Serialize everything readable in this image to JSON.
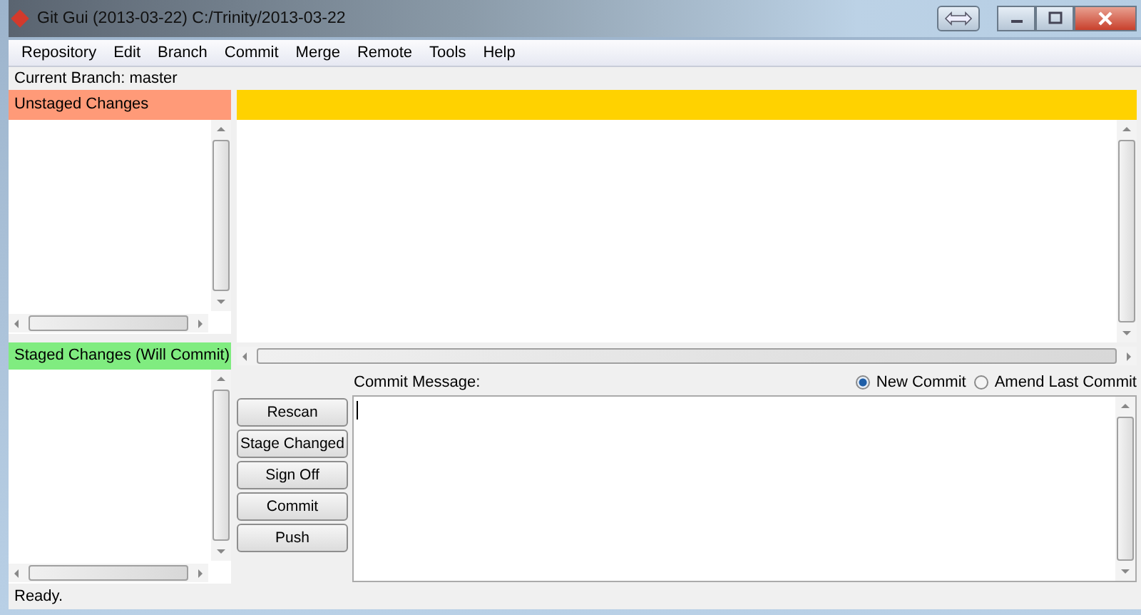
{
  "window": {
    "title": "Git Gui (2013-03-22) C:/Trinity/2013-03-22"
  },
  "menu": [
    "Repository",
    "Edit",
    "Branch",
    "Commit",
    "Merge",
    "Remote",
    "Tools",
    "Help"
  ],
  "current_branch": "Current Branch: master",
  "unstaged": {
    "title": "Unstaged Changes"
  },
  "staged": {
    "title": "Staged Changes (Will Commit)"
  },
  "commit": {
    "label": "Commit Message:",
    "options": [
      {
        "label": "New Commit",
        "selected": true
      },
      {
        "label": "Amend Last Commit",
        "selected": false
      }
    ]
  },
  "buttons": [
    "Rescan",
    "Stage Changed",
    "Sign Off",
    "Commit",
    "Push"
  ],
  "status_bar": "Ready."
}
